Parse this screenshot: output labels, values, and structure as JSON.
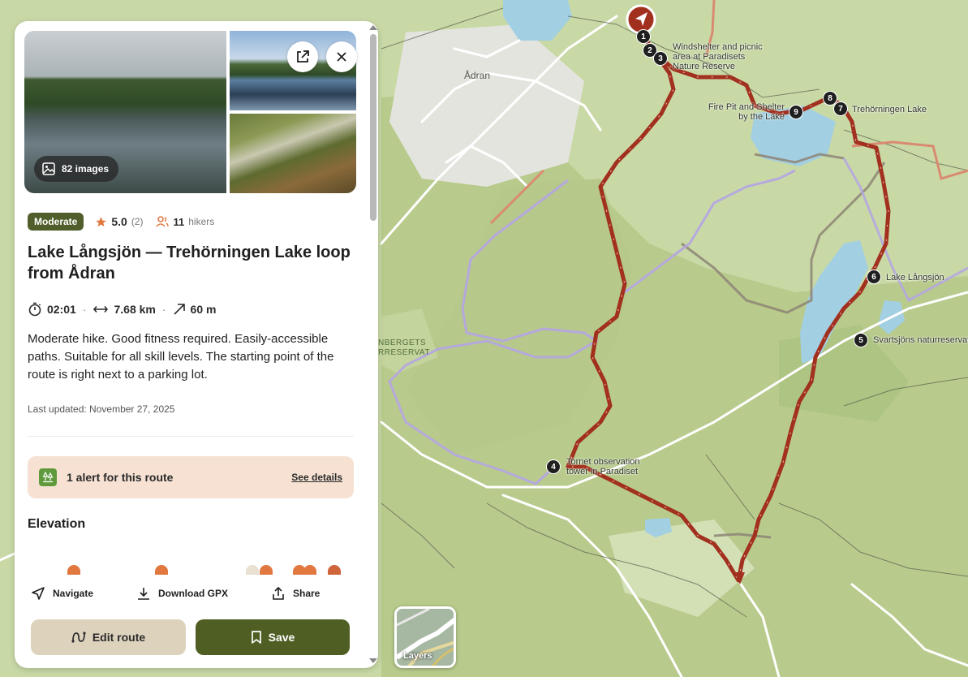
{
  "map": {
    "place_labels": [
      "Ådran"
    ],
    "reserve_label": [
      "NBERGETS",
      "RRESERVAT"
    ],
    "waypoints": [
      {
        "n": "1",
        "label": ""
      },
      {
        "n": "2",
        "label": ""
      },
      {
        "n": "3",
        "label": "Windshelter and picnic\narea at Paradisets\nNature Reserve"
      },
      {
        "n": "4",
        "label": "Tornet observation\ntower in Paradiset"
      },
      {
        "n": "5",
        "label": "Svartsjöns naturreservat"
      },
      {
        "n": "6",
        "label": "Lake Långsjön"
      },
      {
        "n": "7",
        "label": "Trehörningen Lake"
      },
      {
        "n": "8",
        "label": ""
      },
      {
        "n": "9",
        "label": "Fire Pit and Shelter\nby the Lake"
      }
    ],
    "colors": {
      "route": "#a2301f",
      "trail_alt": "#b5a7e0",
      "water": "#a3cfe2",
      "forest": "#b9cc8f"
    }
  },
  "layers_button": {
    "label": "Layers"
  },
  "panel": {
    "images_count_label": "82 images",
    "difficulty": "Moderate",
    "rating": "5.0",
    "rating_count": "(2)",
    "hikers_count": "11",
    "hikers_label": "hikers",
    "title": "Lake Långsjön — Trehörningen Lake loop from Ådran",
    "duration": "02:01",
    "distance": "7.68 km",
    "elevation_gain": "60 m",
    "description": "Moderate hike. Good fitness required. Easily-accessible paths. Suitable for all skill levels. The starting point of the route is right next to a parking lot.",
    "last_updated": "Last updated: November 27, 2025",
    "alert_text": "1 alert for this route",
    "alert_link": "See details",
    "elevation_title": "Elevation",
    "actions": {
      "navigate": "Navigate",
      "download": "Download GPX",
      "share": "Share"
    },
    "edit_button": "Edit route",
    "save_button": "Save",
    "colors": {
      "difficulty_pill": "#4f5e2a",
      "save": "#4f5e22",
      "edit": "#ddd3bd",
      "alert_bg": "#f6e1d3",
      "accent": "#e07840"
    }
  }
}
